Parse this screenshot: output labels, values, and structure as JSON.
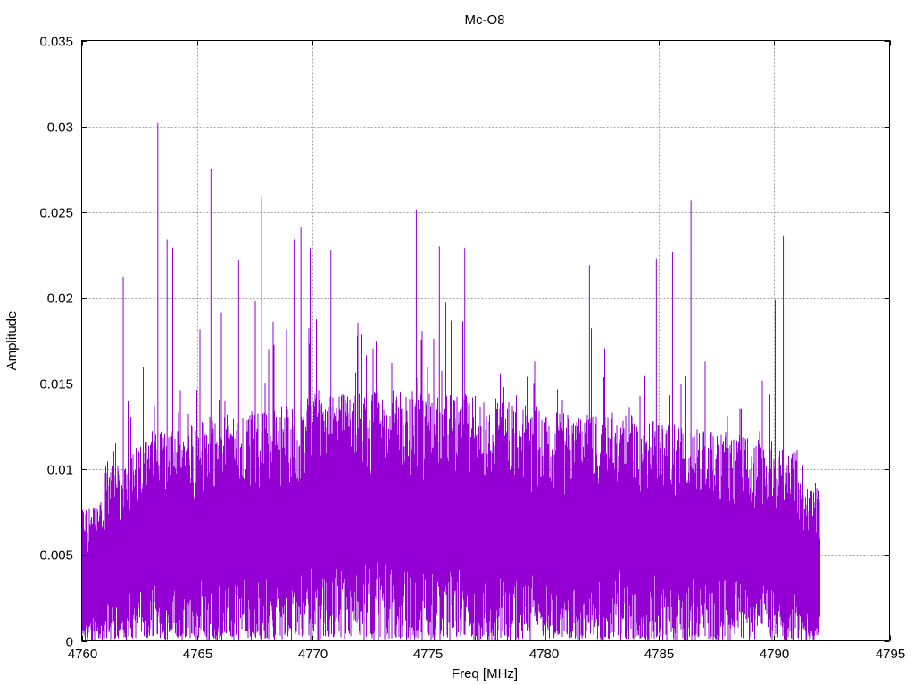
{
  "chart_data": {
    "type": "line",
    "title": "Mc-O8",
    "xlabel": "Freq [MHz]",
    "ylabel": "Amplitude",
    "xlim": [
      4760,
      4795
    ],
    "ylim": [
      0,
      0.035
    ],
    "grid": true,
    "legend": "none",
    "x_ticks": [
      "4760",
      "4765",
      "4770",
      "4775",
      "4780",
      "4785",
      "4790",
      "4795"
    ],
    "x_tick_values": [
      4760,
      4765,
      4770,
      4775,
      4780,
      4785,
      4790,
      4795
    ],
    "y_ticks": [
      "0",
      "0.005",
      "0.01",
      "0.015",
      "0.02",
      "0.025",
      "0.03",
      "0.035"
    ],
    "y_tick_values": [
      0,
      0.005,
      0.01,
      0.015,
      0.02,
      0.025,
      0.03,
      0.035
    ],
    "series_color": "#9400d3",
    "data_range": [
      4760,
      4792
    ],
    "envelope": {
      "description_bins_mhz": 1,
      "bin_start": [
        4760,
        4761,
        4762,
        4763,
        4764,
        4765,
        4766,
        4767,
        4768,
        4769,
        4770,
        4771,
        4772,
        4773,
        4774,
        4775,
        4776,
        4777,
        4778,
        4779,
        4780,
        4781,
        4782,
        4783,
        4784,
        4785,
        4786,
        4787,
        4788,
        4789,
        4790,
        4791
      ],
      "typical_high": [
        0.0068,
        0.0085,
        0.0098,
        0.0105,
        0.0108,
        0.011,
        0.011,
        0.0112,
        0.0115,
        0.0118,
        0.012,
        0.012,
        0.0122,
        0.0122,
        0.0122,
        0.012,
        0.012,
        0.0118,
        0.0116,
        0.0114,
        0.0112,
        0.011,
        0.011,
        0.011,
        0.0108,
        0.0106,
        0.0104,
        0.0102,
        0.01,
        0.0098,
        0.0095,
        0.0078
      ],
      "typical_low": [
        0.0015,
        0.0022,
        0.003,
        0.0032,
        0.0034,
        0.0035,
        0.0036,
        0.0037,
        0.0038,
        0.004,
        0.0042,
        0.0042,
        0.0043,
        0.0043,
        0.0043,
        0.0042,
        0.0042,
        0.0041,
        0.004,
        0.004,
        0.0039,
        0.0039,
        0.0038,
        0.0038,
        0.0037,
        0.0036,
        0.0035,
        0.0034,
        0.0033,
        0.0031,
        0.0028,
        0.002
      ],
      "peak": [
        0.0085,
        0.0135,
        0.0212,
        0.0302,
        0.0165,
        0.0275,
        0.0222,
        0.0259,
        0.0215,
        0.0241,
        0.0229,
        0.021,
        0.0205,
        0.0195,
        0.0251,
        0.023,
        0.0229,
        0.0195,
        0.018,
        0.018,
        0.0178,
        0.0182,
        0.0219,
        0.018,
        0.0185,
        0.0227,
        0.0257,
        0.019,
        0.017,
        0.018,
        0.0236,
        0.0125
      ]
    },
    "notable_peaks": [
      {
        "x": 4761.8,
        "y": 0.0212
      },
      {
        "x": 4763.3,
        "y": 0.0302
      },
      {
        "x": 4763.7,
        "y": 0.0234
      },
      {
        "x": 4765.6,
        "y": 0.0275
      },
      {
        "x": 4766.8,
        "y": 0.0222
      },
      {
        "x": 4767.8,
        "y": 0.0259
      },
      {
        "x": 4769.2,
        "y": 0.0234
      },
      {
        "x": 4769.5,
        "y": 0.0241
      },
      {
        "x": 4769.9,
        "y": 0.0229
      },
      {
        "x": 4770.8,
        "y": 0.0228
      },
      {
        "x": 4774.5,
        "y": 0.0251
      },
      {
        "x": 4775.5,
        "y": 0.023
      },
      {
        "x": 4776.6,
        "y": 0.0229
      },
      {
        "x": 4782.0,
        "y": 0.0219
      },
      {
        "x": 4784.9,
        "y": 0.0223
      },
      {
        "x": 4785.6,
        "y": 0.0227
      },
      {
        "x": 4786.4,
        "y": 0.0257
      },
      {
        "x": 4790.4,
        "y": 0.0236
      }
    ]
  }
}
